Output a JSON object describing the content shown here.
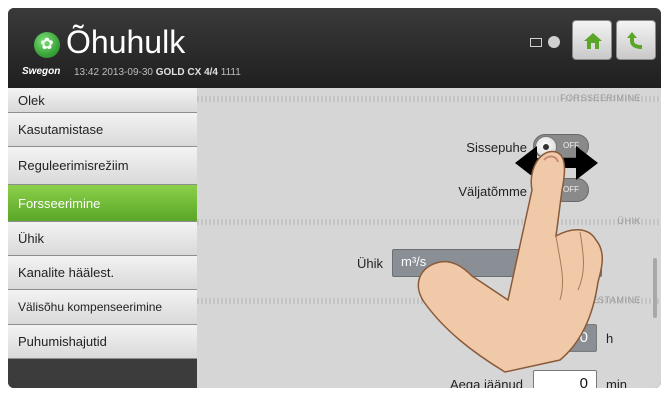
{
  "header": {
    "app_title": "Õhuhulk",
    "brand": "Swegon",
    "time": "13:42",
    "date": "2013-09-30",
    "model": "GOLD CX",
    "fraction": "4/4",
    "code": "1111",
    "icons": [
      "network-icon",
      "user-icon",
      "home-icon",
      "back-icon"
    ]
  },
  "sidebar": {
    "items": [
      {
        "label": "Olek"
      },
      {
        "label": "Kasutamistase"
      },
      {
        "label": "Reguleerimisrežiim"
      },
      {
        "label": "Forsseerimine"
      },
      {
        "label": "Ühik"
      },
      {
        "label": "Kanalite häälest."
      },
      {
        "label": "Välisõhu kompenseerimine"
      },
      {
        "label": "Puhumishajutid"
      }
    ],
    "active_index": 3
  },
  "main": {
    "sections": {
      "forced": "FORSSEERIMINE",
      "unit": "ÜHIK",
      "tuning": "ESTAMINE"
    },
    "supply_label": "Sissepuhe",
    "supply_state": "OFF",
    "exhaust_label": "Väljatõmme",
    "exhaust_state": "OFF",
    "unit_label": "Ühik",
    "unit_option": "m³/s",
    "hours_value": "0",
    "hours_unit": "h",
    "remaining_label": "Aega jäänud",
    "minutes_value": "0",
    "minutes_unit": "min"
  },
  "colors": {
    "accent_green": "#6ab832",
    "header_bg": "#2b2b2b",
    "content_bg": "#d6d6d6"
  }
}
